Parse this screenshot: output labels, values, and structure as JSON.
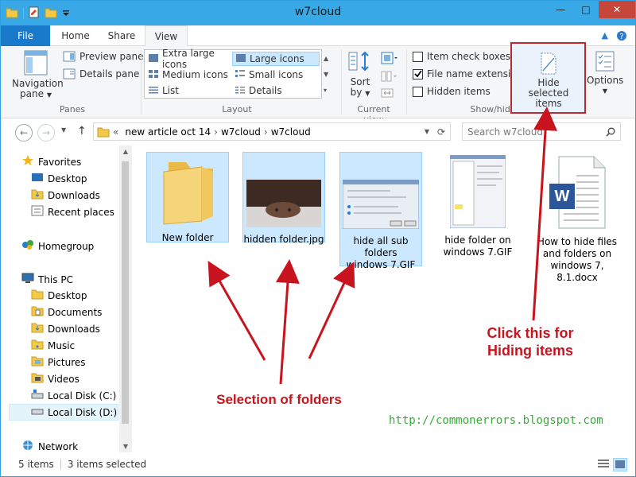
{
  "window": {
    "title": "w7cloud",
    "minimize": "—",
    "maximize": "□",
    "close": "✕"
  },
  "tabs": {
    "file": "File",
    "home": "Home",
    "share": "Share",
    "view": "View",
    "active": "View"
  },
  "ribbon": {
    "panes": {
      "navigation_pane_line1": "Navigation",
      "navigation_pane_line2": "pane",
      "preview_pane": "Preview pane",
      "details_pane": "Details pane",
      "label": "Panes"
    },
    "layout": {
      "items": [
        {
          "label": "Extra large icons",
          "icon": "extra-large-icons-icon",
          "selected": false
        },
        {
          "label": "Large icons",
          "icon": "large-icons-icon",
          "selected": true
        },
        {
          "label": "Medium icons",
          "icon": "medium-icons-icon",
          "selected": false
        },
        {
          "label": "Small icons",
          "icon": "small-icons-icon",
          "selected": false
        },
        {
          "label": "List",
          "icon": "list-icon",
          "selected": false
        },
        {
          "label": "Details",
          "icon": "details-icon",
          "selected": false
        }
      ],
      "label": "Layout"
    },
    "current_view": {
      "sort_by_line1": "Sort",
      "sort_by_line2": "by",
      "label": "Current view"
    },
    "show_hide": {
      "item_check_boxes": {
        "label": "Item check boxes",
        "checked": false
      },
      "file_name_extensions": {
        "label": "File name extensions",
        "checked": true
      },
      "hidden_items": {
        "label": "Hidden items",
        "checked": false
      },
      "hide_selected_line1": "Hide selected",
      "hide_selected_line2": "items",
      "label": "Show/hide"
    },
    "options": {
      "label": "Options"
    }
  },
  "address": {
    "overflow": "«",
    "crumbs": [
      "new article oct 14",
      "w7cloud",
      "w7cloud"
    ],
    "separator": "›",
    "search_placeholder": "Search w7cloud"
  },
  "navpane": {
    "favorites": "Favorites",
    "desktop": "Desktop",
    "downloads": "Downloads",
    "recent_places": "Recent places",
    "homegroup": "Homegroup",
    "this_pc": "This PC",
    "pc_desktop": "Desktop",
    "documents": "Documents",
    "pc_downloads": "Downloads",
    "music": "Music",
    "pictures": "Pictures",
    "videos": "Videos",
    "local_c": "Local Disk (C:)",
    "local_d": "Local Disk (D:)",
    "network": "Network"
  },
  "files": [
    {
      "name": "New folder",
      "selected": true
    },
    {
      "name": "hidden folder.jpg",
      "selected": true
    },
    {
      "name": "hide all sub folders windows 7.GIF",
      "selected": true
    },
    {
      "name": "hide folder on windows 7.GIF",
      "selected": false
    },
    {
      "name": "How to hide files and folders on windows 7, 8.1.docx",
      "selected": false
    }
  ],
  "annotations": {
    "click_this_line1": "Click this for",
    "click_this_line2": "Hiding items",
    "selection": "Selection of folders",
    "url": "http://commonerrors.blogspot.com"
  },
  "status": {
    "items": "5 items",
    "selected": "3 items selected"
  },
  "colors": {
    "title_bar": "#38a9e6",
    "file_tab": "#1979ca",
    "selection": "#cce8ff",
    "annotation": "#c8141e",
    "url": "#3aa83a"
  }
}
